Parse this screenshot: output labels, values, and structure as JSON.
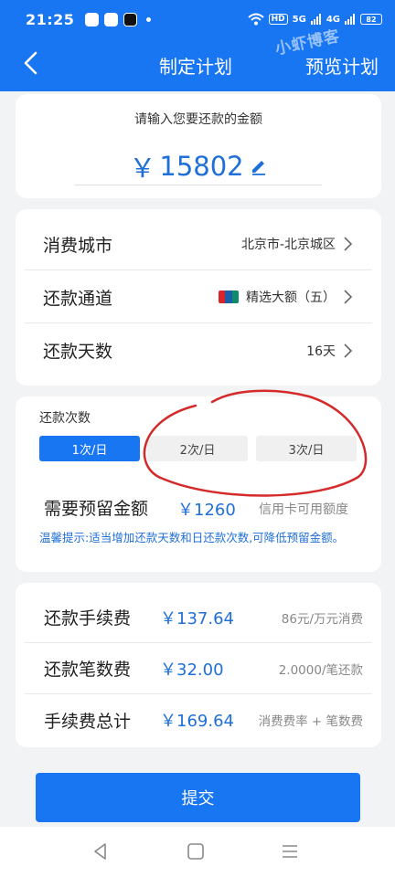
{
  "status_bar": {
    "time": "21:25",
    "hd": "HD",
    "signal1": "5G",
    "signal2": "4G",
    "battery": "82"
  },
  "nav": {
    "title": "制定计划",
    "watermark": "小虾博客",
    "preview_label": "预览计划"
  },
  "amount": {
    "prompt": "请输入您要还款的金额",
    "currency": "￥",
    "value": "15802"
  },
  "info": {
    "rows": [
      {
        "label": "消费城市",
        "value": "北京市-北京城区"
      },
      {
        "label": "还款通道",
        "value": "精选大额（五）"
      },
      {
        "label": "还款天数",
        "value": "16天"
      }
    ]
  },
  "repay_count": {
    "label": "还款次数",
    "options": [
      "1次/日",
      "2次/日",
      "3次/日"
    ],
    "selected": "1次/日",
    "reserve_label": "需要预留金额",
    "reserve_value": "￥1260",
    "reserve_note": "信用卡可用额度",
    "tip": "温馨提示:适当增加还款天数和日还款次数,可降低预留金额。"
  },
  "fees": {
    "rows": [
      {
        "label": "还款手续费",
        "value": "￥137.64",
        "note": "86元/万元消费"
      },
      {
        "label": "还款笔数费",
        "value": "￥32.00",
        "note": "2.0000/笔还款"
      },
      {
        "label": "手续费总计",
        "value": "￥169.64",
        "note": "消费费率 + 笔数费"
      }
    ]
  },
  "submit_label": "提交",
  "colors": {
    "brand_blue": "#1976f2",
    "value_blue": "#1f6fd8",
    "annotation_red": "#d42a2a",
    "background": "#f2f3f5"
  },
  "icons": [
    "back-arrow-icon",
    "edit-pencil-icon",
    "unionpay-logo",
    "chevron-right-icon",
    "nav-back-icon",
    "nav-home-icon",
    "nav-menu-icon"
  ]
}
